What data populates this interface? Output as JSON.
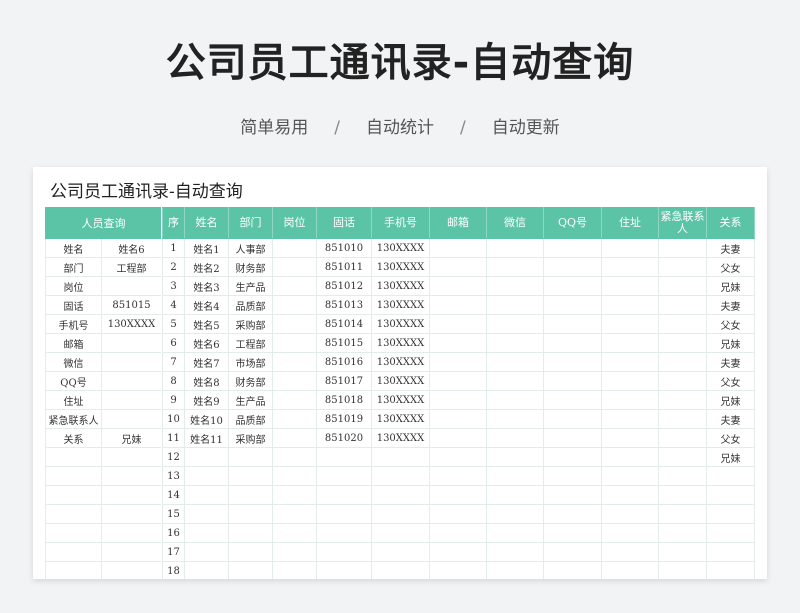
{
  "hero": {
    "title": "公司员工通讯录-自动查询",
    "subtitle": [
      "简单易用",
      "自动统计",
      "自动更新"
    ],
    "separator": "/"
  },
  "sheet": {
    "title": "公司员工通讯录-自动查询"
  },
  "lookup": {
    "header": "人员查询",
    "rows": [
      {
        "key": "姓名",
        "value": "姓名6"
      },
      {
        "key": "部门",
        "value": "工程部"
      },
      {
        "key": "岗位",
        "value": ""
      },
      {
        "key": "固话",
        "value": "851015"
      },
      {
        "key": "手机号",
        "value": "130XXXX"
      },
      {
        "key": "邮箱",
        "value": ""
      },
      {
        "key": "微信",
        "value": ""
      },
      {
        "key": "QQ号",
        "value": ""
      },
      {
        "key": "住址",
        "value": ""
      },
      {
        "key": "紧急联系人",
        "value": ""
      },
      {
        "key": "关系",
        "value": "兄妹"
      },
      {
        "key": "",
        "value": ""
      },
      {
        "key": "",
        "value": ""
      },
      {
        "key": "",
        "value": ""
      },
      {
        "key": "",
        "value": ""
      },
      {
        "key": "",
        "value": ""
      },
      {
        "key": "",
        "value": ""
      },
      {
        "key": "",
        "value": ""
      }
    ]
  },
  "directory": {
    "columns": [
      "序",
      "姓名",
      "部门",
      "岗位",
      "固话",
      "手机号",
      "邮箱",
      "微信",
      "QQ号",
      "住址",
      "紧急联系人",
      "关系"
    ],
    "rows": [
      [
        "1",
        "姓名1",
        "人事部",
        "",
        "851010",
        "130XXXX",
        "",
        "",
        "",
        "",
        "",
        "夫妻"
      ],
      [
        "2",
        "姓名2",
        "财务部",
        "",
        "851011",
        "130XXXX",
        "",
        "",
        "",
        "",
        "",
        "父女"
      ],
      [
        "3",
        "姓名3",
        "生产品",
        "",
        "851012",
        "130XXXX",
        "",
        "",
        "",
        "",
        "",
        "兄妹"
      ],
      [
        "4",
        "姓名4",
        "品质部",
        "",
        "851013",
        "130XXXX",
        "",
        "",
        "",
        "",
        "",
        "夫妻"
      ],
      [
        "5",
        "姓名5",
        "采购部",
        "",
        "851014",
        "130XXXX",
        "",
        "",
        "",
        "",
        "",
        "父女"
      ],
      [
        "6",
        "姓名6",
        "工程部",
        "",
        "851015",
        "130XXXX",
        "",
        "",
        "",
        "",
        "",
        "兄妹"
      ],
      [
        "7",
        "姓名7",
        "市场部",
        "",
        "851016",
        "130XXXX",
        "",
        "",
        "",
        "",
        "",
        "夫妻"
      ],
      [
        "8",
        "姓名8",
        "财务部",
        "",
        "851017",
        "130XXXX",
        "",
        "",
        "",
        "",
        "",
        "父女"
      ],
      [
        "9",
        "姓名9",
        "生产品",
        "",
        "851018",
        "130XXXX",
        "",
        "",
        "",
        "",
        "",
        "兄妹"
      ],
      [
        "10",
        "姓名10",
        "品质部",
        "",
        "851019",
        "130XXXX",
        "",
        "",
        "",
        "",
        "",
        "夫妻"
      ],
      [
        "11",
        "姓名11",
        "采购部",
        "",
        "851020",
        "130XXXX",
        "",
        "",
        "",
        "",
        "",
        "父女"
      ],
      [
        "12",
        "",
        "",
        "",
        "",
        "",
        "",
        "",
        "",
        "",
        "",
        "兄妹"
      ],
      [
        "13",
        "",
        "",
        "",
        "",
        "",
        "",
        "",
        "",
        "",
        "",
        ""
      ],
      [
        "14",
        "",
        "",
        "",
        "",
        "",
        "",
        "",
        "",
        "",
        "",
        ""
      ],
      [
        "15",
        "",
        "",
        "",
        "",
        "",
        "",
        "",
        "",
        "",
        "",
        ""
      ],
      [
        "16",
        "",
        "",
        "",
        "",
        "",
        "",
        "",
        "",
        "",
        "",
        ""
      ],
      [
        "17",
        "",
        "",
        "",
        "",
        "",
        "",
        "",
        "",
        "",
        "",
        ""
      ],
      [
        "18",
        "",
        "",
        "",
        "",
        "",
        "",
        "",
        "",
        "",
        "",
        ""
      ]
    ]
  },
  "colors": {
    "header_bg": "#5cc4a6",
    "header_text": "#ffffff",
    "grid_line": "#e3ece9"
  }
}
